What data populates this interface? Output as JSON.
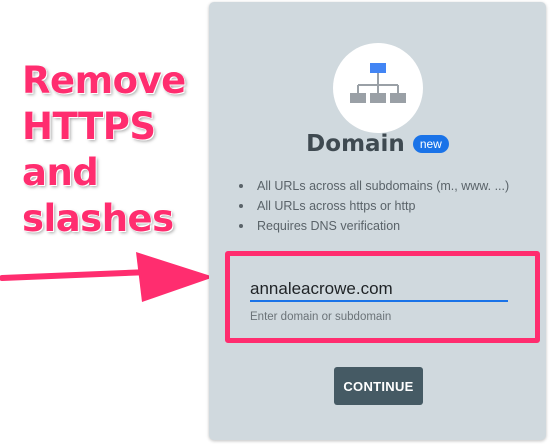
{
  "annotation": {
    "lines": [
      "Remove",
      "HTTPS",
      "and",
      "slashes"
    ],
    "color": "#ff2d6f"
  },
  "card": {
    "icon": "domain-sitemap-icon",
    "title": "Domain",
    "badge": "new",
    "features": [
      "All URLs across all subdomains (m., www. ...)",
      "All URLs across https or http",
      "Requires DNS verification"
    ],
    "input": {
      "value": "annaleacrowe.com",
      "helper": "Enter domain or subdomain"
    },
    "continue_label": "CONTINUE"
  },
  "colors": {
    "card_bg": "#d0d9de",
    "accent_blue": "#1a73e8",
    "button_bg": "#455a64",
    "highlight": "#ff2d6f"
  }
}
